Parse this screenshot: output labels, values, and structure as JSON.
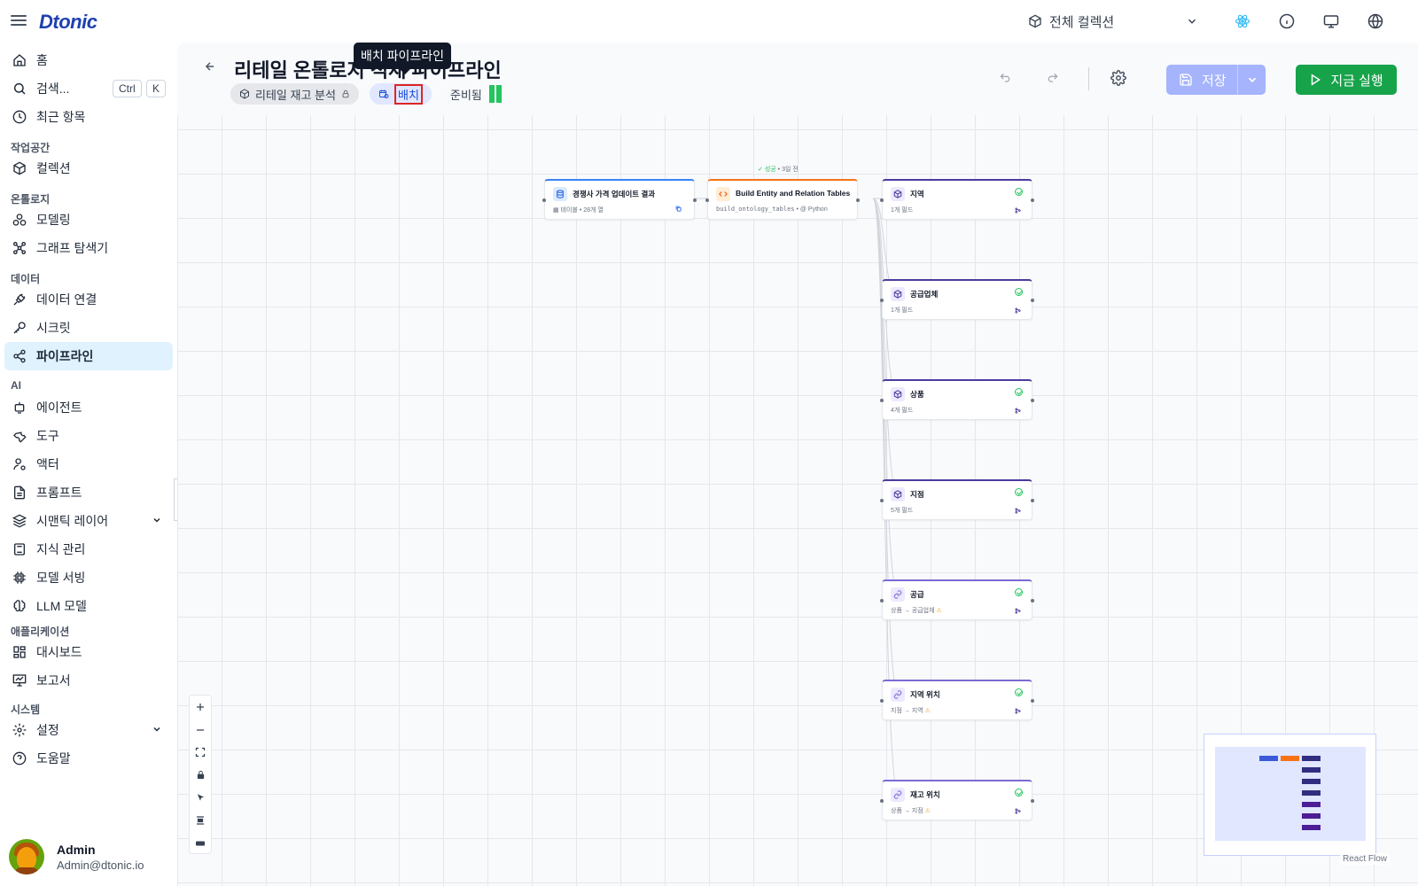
{
  "app": {
    "logo": "Dtonic"
  },
  "topbar": {
    "collection": "전체 컬렉션"
  },
  "sidebar": {
    "home": "홈",
    "search": "검색...",
    "search_kbd": [
      "Ctrl",
      "K"
    ],
    "recent": "최근 항목",
    "sections": {
      "workspace": "작업공간",
      "ontology": "온톨로지",
      "data": "데이터",
      "ai": "AI",
      "apps": "애플리케이션",
      "system": "시스템"
    },
    "items": {
      "collection": "컬렉션",
      "modeling": "모델링",
      "graph_explorer": "그래프 탐색기",
      "data_connection": "데이터 연결",
      "secret": "시크릿",
      "pipeline": "파이프라인",
      "agent": "에이전트",
      "tool": "도구",
      "actor": "액터",
      "prompt": "프롬프트",
      "semantic_layer": "시맨틱 레이어",
      "knowledge": "지식 관리",
      "model_serving": "모델 서빙",
      "llm_model": "LLM 모델",
      "dashboard": "대시보드",
      "report": "보고서",
      "settings": "설정",
      "help": "도움말"
    },
    "user": {
      "name": "Admin",
      "email": "Admin@dtonic.io"
    }
  },
  "header": {
    "title": "리테일 온톨로지 적재 파이프라인",
    "tooltip": "배치 파이프라인",
    "chip_project": "리테일 재고 분석",
    "chip_batch": "배치",
    "status": "준비됨",
    "save": "저장",
    "run": "지금 실행"
  },
  "canvas": {
    "status_tag": {
      "state": "성공",
      "time": "3일 전"
    },
    "nodes": {
      "source": {
        "title": "경쟁사 가격 업데이트 결과",
        "sub": "테이블 • 28개 열"
      },
      "transform": {
        "title": "Build Entity and Relation Tables",
        "sub_code": "build_ontology_tables",
        "sub_lang": "• @ Python"
      },
      "region": {
        "title": "지역",
        "sub": "1개 필드"
      },
      "supplier": {
        "title": "공급업체",
        "sub": "1개 필드"
      },
      "product": {
        "title": "상품",
        "sub": "4개 필드"
      },
      "store": {
        "title": "지점",
        "sub": "5개 필드"
      },
      "supply": {
        "title": "공급",
        "sub": "상품 → 공급업체"
      },
      "region_location": {
        "title": "지역 위치",
        "sub": "지점 → 지역"
      },
      "stock_location": {
        "title": "재고 위치",
        "sub": "상품 → 지점"
      }
    },
    "attribution": "React Flow"
  },
  "colors": {
    "accent": "#2563eb",
    "run": "#16a34a",
    "save": "#a5b4fc",
    "entity": "#4c3b9e",
    "relation": "#7c6ad4",
    "source": "#3b82f6",
    "transform": "#f97316"
  }
}
